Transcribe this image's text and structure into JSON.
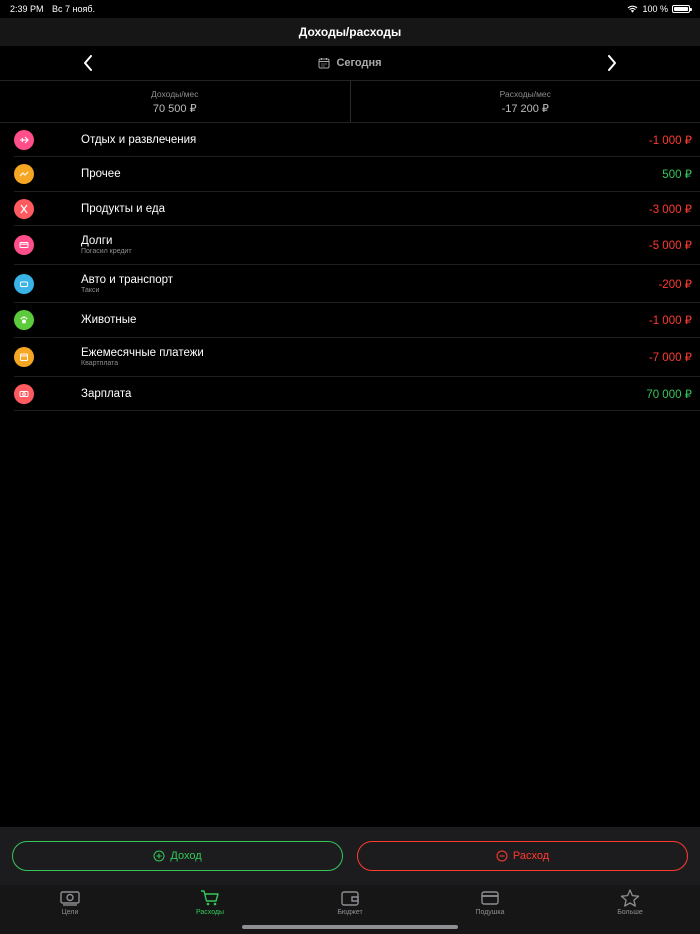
{
  "status": {
    "time": "2:39 PM",
    "date": "Вс 7 нояб.",
    "battery": "100 %"
  },
  "header": {
    "title": "Доходы/расходы"
  },
  "date_nav": {
    "label": "Сегодня"
  },
  "summary": {
    "income_label": "Доходы/мес",
    "income_value": "70 500 ₽",
    "expense_label": "Расходы/мес",
    "expense_value": "-17 200 ₽"
  },
  "rows": [
    {
      "name": "Отдых и развлечения",
      "sub": "",
      "amount": "-1 000 ₽",
      "icon_color": "#ff4f8b",
      "icon": "plane-icon"
    },
    {
      "name": "Прочее",
      "sub": "",
      "amount": "500 ₽",
      "icon_color": "#f5a623",
      "icon": "trend-icon"
    },
    {
      "name": "Продукты и еда",
      "sub": "",
      "amount": "-3 000 ₽",
      "icon_color": "#ff5a5f",
      "icon": "cutlery-icon"
    },
    {
      "name": "Долги",
      "sub": "Погасил кредит",
      "amount": "-5 000 ₽",
      "icon_color": "#ff4f8b",
      "icon": "card-icon"
    },
    {
      "name": "Авто и транспорт",
      "sub": "Такси",
      "amount": "-200 ₽",
      "icon_color": "#3ab4e6",
      "icon": "car-icon"
    },
    {
      "name": "Животные",
      "sub": "",
      "amount": "-1 000 ₽",
      "icon_color": "#5ccb3b",
      "icon": "paw-icon"
    },
    {
      "name": "Ежемесячные платежи",
      "sub": "Квартплата",
      "amount": "-7 000 ₽",
      "icon_color": "#f5a623",
      "icon": "calendar-icon"
    },
    {
      "name": "Зарплата",
      "sub": "",
      "amount": "70 000 ₽",
      "icon_color": "#ff5a5f",
      "icon": "money-icon"
    }
  ],
  "actions": {
    "income": "Доход",
    "expense": "Расход"
  },
  "tabs": [
    {
      "label": "Цели",
      "icon": "money-icon"
    },
    {
      "label": "Расходы",
      "icon": "cart-icon"
    },
    {
      "label": "Бюджет",
      "icon": "wallet-icon"
    },
    {
      "label": "Подушка",
      "icon": "card-icon"
    },
    {
      "label": "Больше",
      "icon": "star-icon"
    }
  ],
  "colors": {
    "positive": "#34c759",
    "negative": "#ff3b30"
  }
}
